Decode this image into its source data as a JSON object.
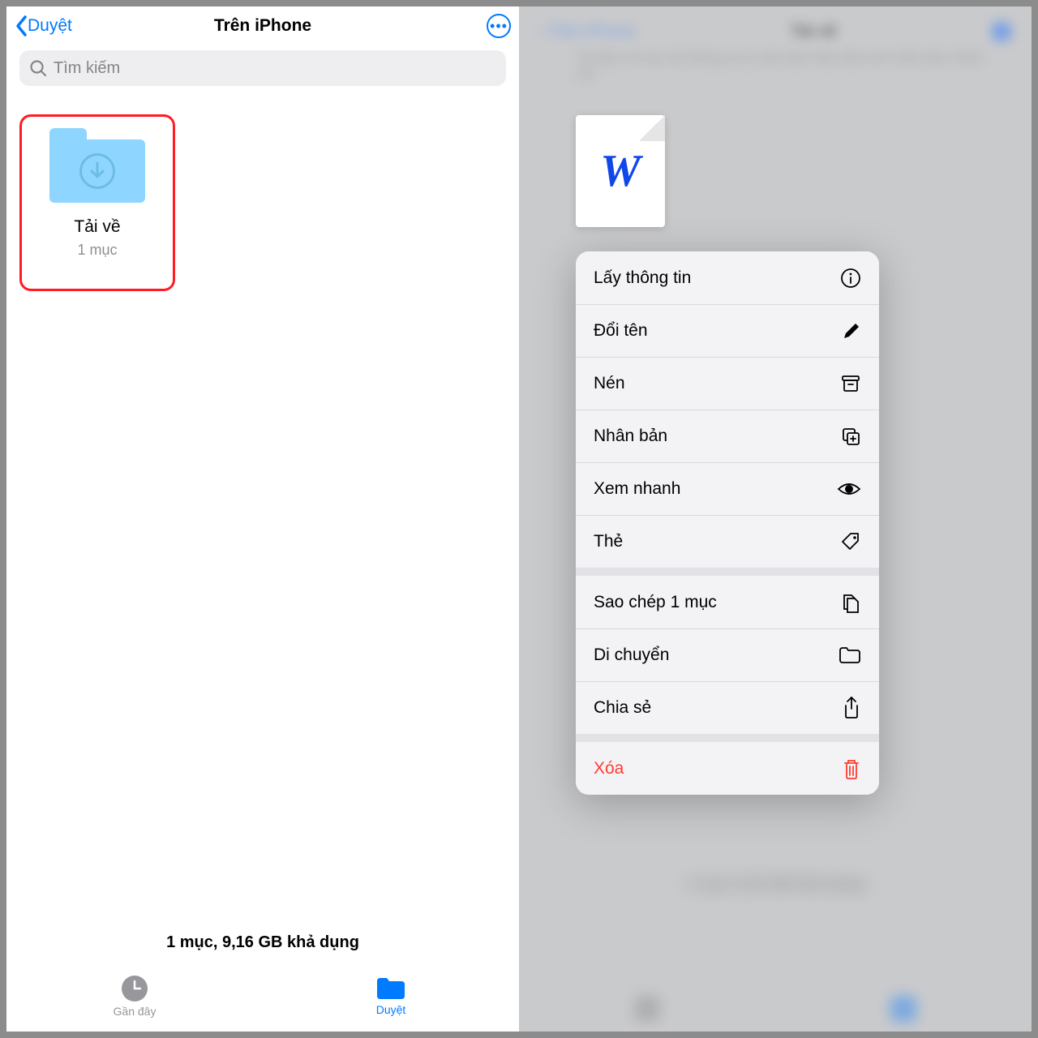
{
  "left": {
    "back_label": "Duyệt",
    "title": "Trên iPhone",
    "search_placeholder": "Tìm kiếm",
    "folder": {
      "name": "Tải về",
      "subtitle": "1 mục"
    },
    "footer": "1 mục, 9,16 GB khả dụng",
    "tabs": {
      "recent": "Gần đây",
      "browse": "Duyệt"
    }
  },
  "right": {
    "file_letter": "W",
    "menu": {
      "info": "Lấy thông tin",
      "rename": "Đổi tên",
      "compress": "Nén",
      "duplicate": "Nhân bản",
      "quicklook": "Xem nhanh",
      "tag": "Thẻ",
      "copy": "Sao chép 1 mục",
      "move": "Di chuyển",
      "share": "Chia sẻ",
      "delete": "Xóa"
    }
  }
}
